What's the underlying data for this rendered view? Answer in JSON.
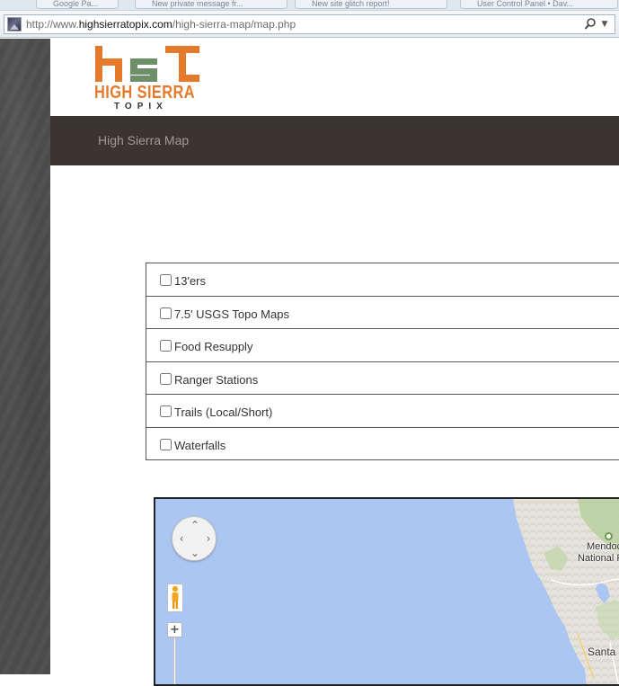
{
  "browser": {
    "tabs": [
      "Google Pa...",
      "New private message fr...",
      "New site glitch report!",
      "User Control Panel • Dav..."
    ],
    "address": {
      "scheme": "http://www.",
      "host": "highsierratopix.com",
      "path": "/high-sierra-map/map.php"
    },
    "icons": {
      "favicon": "site-favicon",
      "search": "search-icon",
      "dropdown": "chevron-down-icon"
    }
  },
  "site": {
    "logo": {
      "title": "HIGH SIERRA",
      "subtitle": "TOPIX",
      "colors": {
        "orange": "#e57a2d",
        "green": "#6f8f6b"
      }
    },
    "nav": {
      "items": [
        {
          "label": "High Sierra Map"
        }
      ]
    }
  },
  "layers": {
    "items": [
      {
        "label": "13'ers",
        "checked": false
      },
      {
        "label": "7.5' USGS Topo Maps",
        "checked": false
      },
      {
        "label": "Food Resupply",
        "checked": false
      },
      {
        "label": "Ranger Stations",
        "checked": false
      },
      {
        "label": "Trails (Local/Short)",
        "checked": false
      },
      {
        "label": "Waterfalls",
        "checked": false
      }
    ]
  },
  "map": {
    "labels": {
      "mendocino": "Mendoci",
      "national_forest": "National F",
      "santa": "Santa"
    },
    "controls": {
      "zoom_in": "+"
    },
    "colors": {
      "water": "#abc6f2",
      "land": "#e8e4da"
    }
  }
}
